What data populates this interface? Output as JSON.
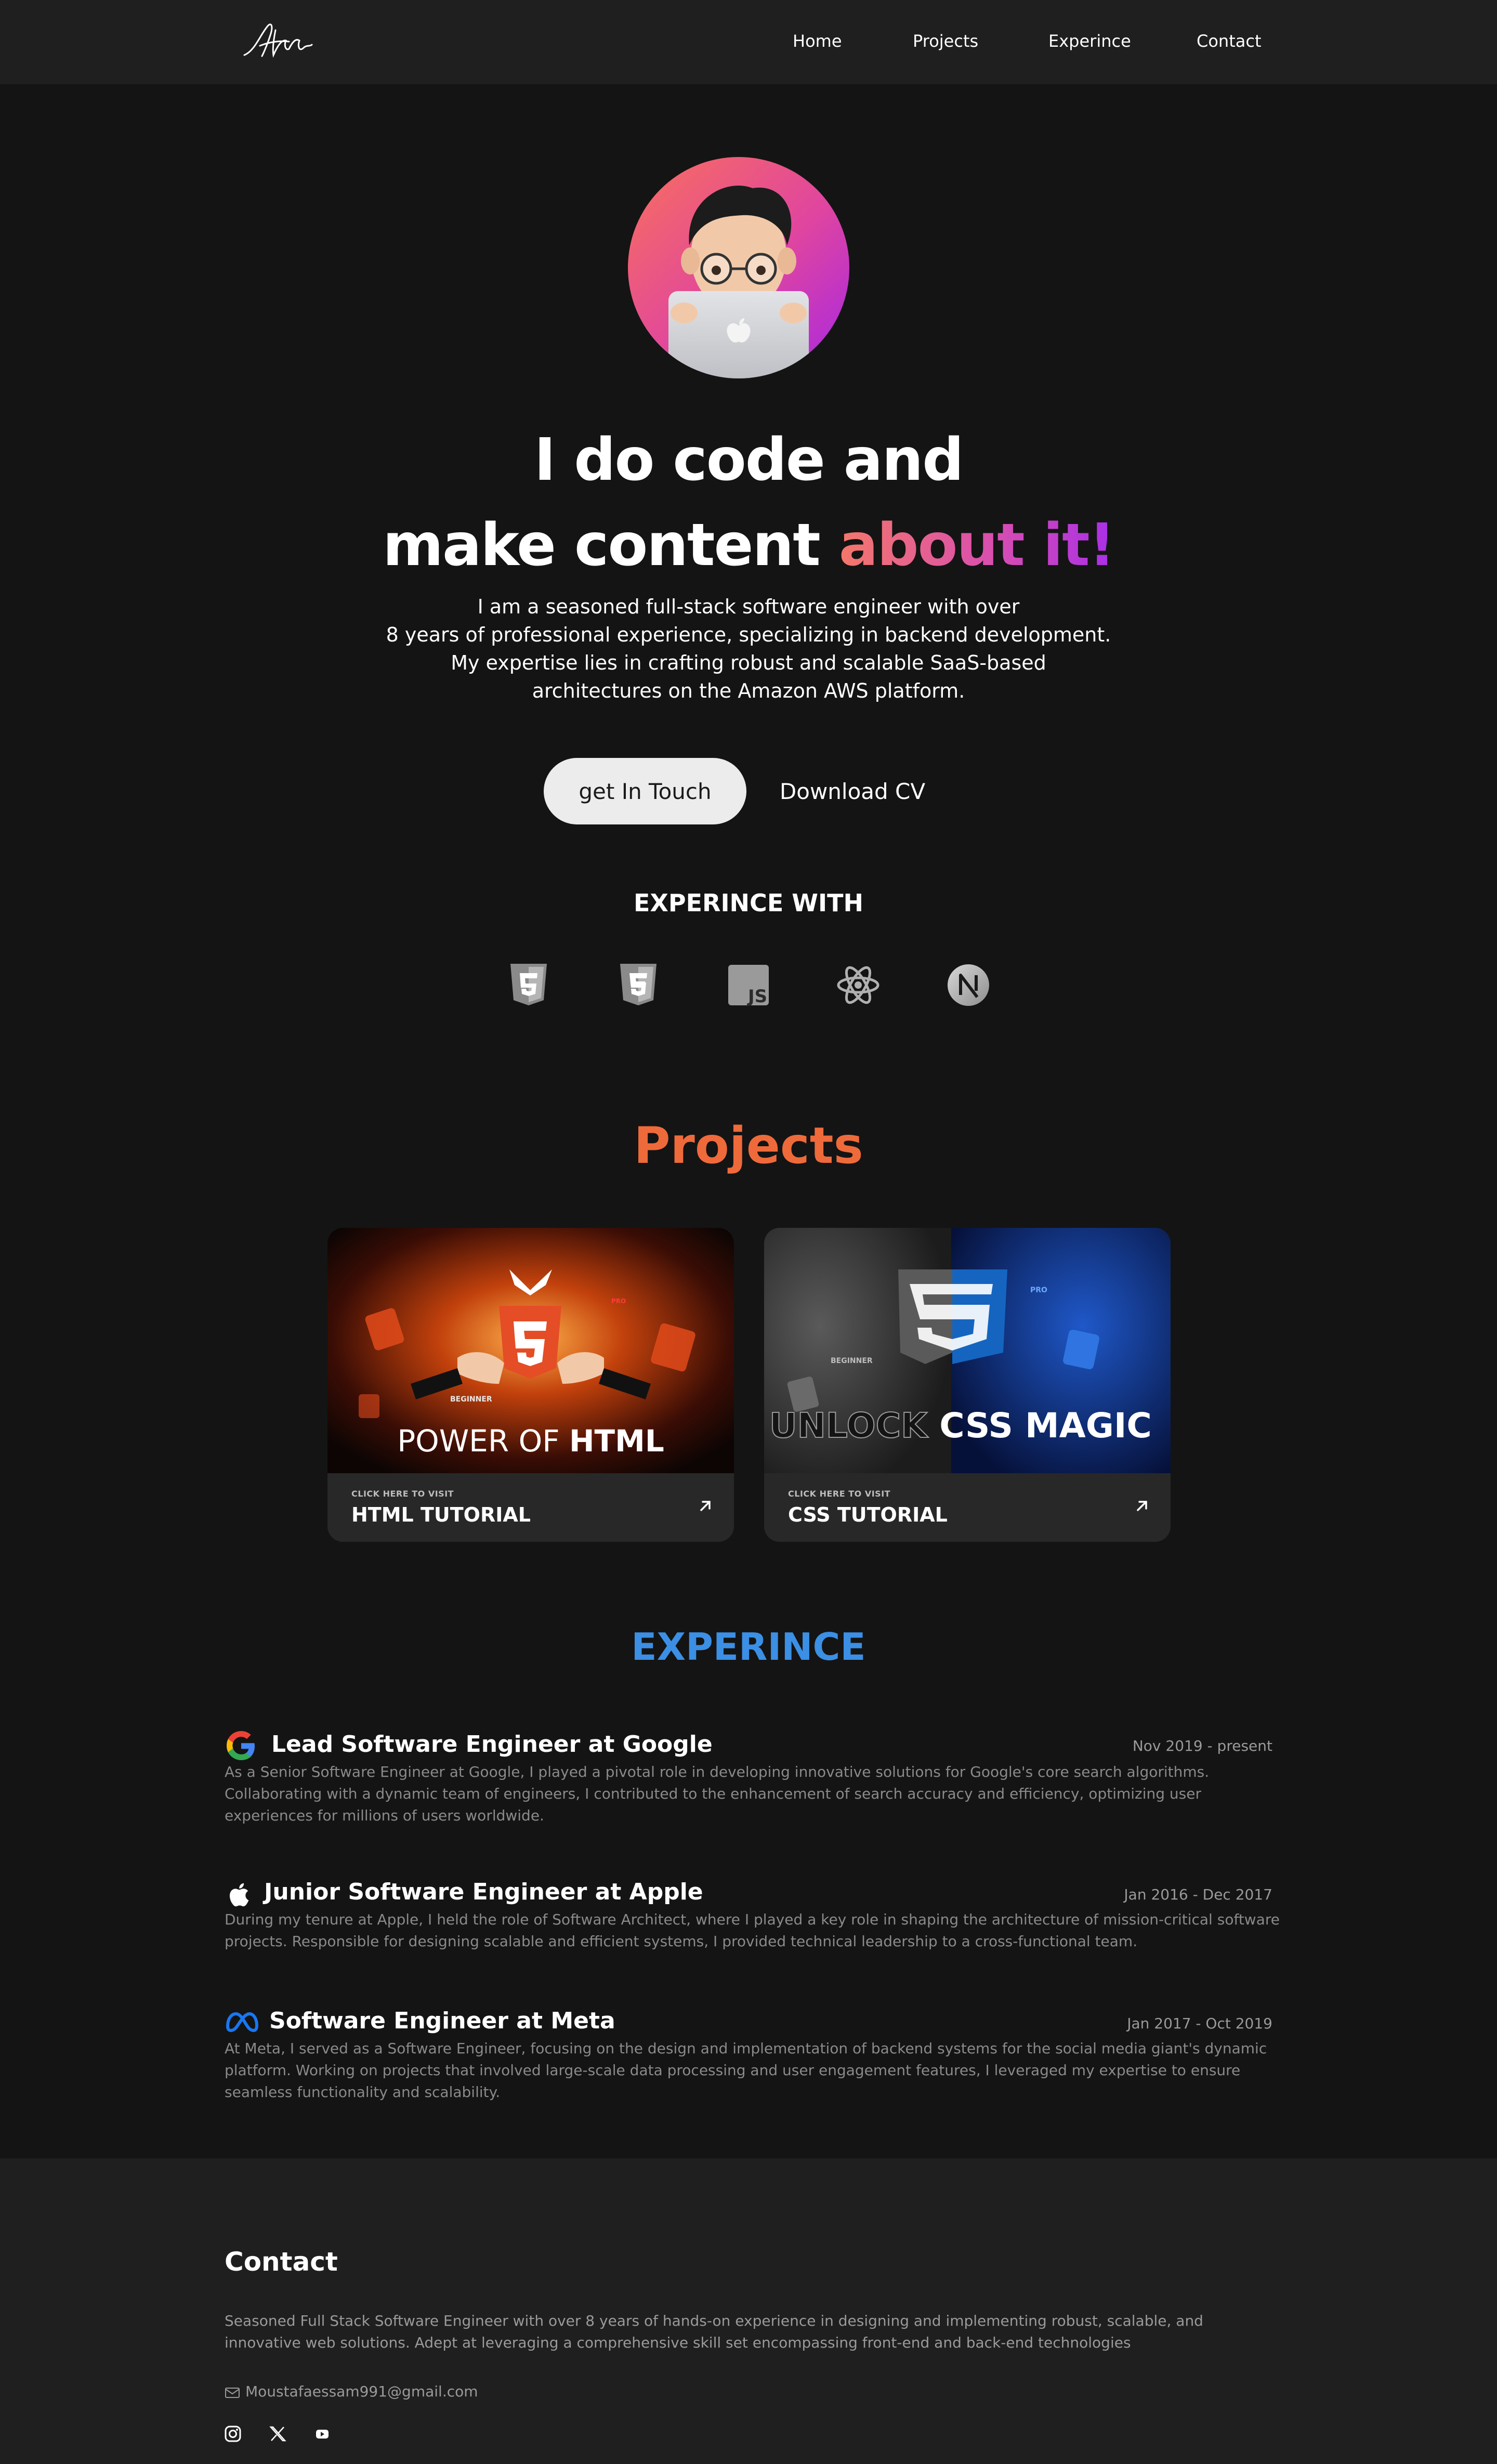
{
  "nav": {
    "logo_alt": "signature-logo",
    "links": [
      "Home",
      "Projects",
      "Experince",
      "Contact"
    ]
  },
  "hero": {
    "title_line1": "I do code and",
    "title_line2_plain": "make content ",
    "title_line2_accent": "about it!",
    "description": [
      "I am a seasoned full-stack software engineer with over",
      "8 years of professional experience, specializing in backend development.",
      "My expertise lies in crafting robust and scalable SaaS-based",
      "architectures on the Amazon AWS platform."
    ],
    "cta_primary": "get In Touch",
    "cta_secondary": "Download CV",
    "accent_gradient": [
      "#f4776b",
      "#d94fae",
      "#a92fe8"
    ]
  },
  "experience_with": {
    "title": "EXPERINCE WITH",
    "icons": [
      "html5-icon",
      "css3-icon",
      "javascript-icon",
      "react-icon",
      "nextjs-icon"
    ]
  },
  "projects": {
    "title": "Projects",
    "title_color": "#ef6a3a",
    "cards": [
      {
        "image_label_beginner": "BEGINNER",
        "image_label_pro": "PRO",
        "image_title_plain": "POWER OF ",
        "image_title_bold": "HTML",
        "small": "CLICK HERE TO VISIT",
        "big": "HTML TUTORIAL"
      },
      {
        "image_label_beginner": "BEGINNER",
        "image_label_pro": "PRO",
        "image_title_plain": "UNLOCK ",
        "image_title_bold": "CSS MAGIC",
        "small": "CLICK HERE TO VISIT",
        "big": "CSS TUTORIAL"
      }
    ]
  },
  "experience": {
    "title": "EXPERINCE",
    "title_color": "#3b8fe4",
    "items": [
      {
        "logo": "google-icon",
        "role": "Lead Software Engineer at Google",
        "date": "Nov 2019 - present",
        "description": [
          "As a Senior Software Engineer at Google, I played a pivotal role in developing innovative solutions for Google's core search algorithms.",
          "Collaborating with a dynamic team of engineers, I contributed to the enhancement of search accuracy and efficiency, optimizing user",
          "experiences for millions of users worldwide."
        ]
      },
      {
        "logo": "apple-icon",
        "role": "Junior Software Engineer at Apple",
        "date": "Jan 2016 - Dec 2017",
        "description": [
          "During my tenure at Apple, I held the role of Software Architect, where I played a key role in shaping the architecture of mission-critical software",
          "projects. Responsible for designing scalable and efficient systems, I provided technical leadership to a cross-functional team."
        ]
      },
      {
        "logo": "meta-icon",
        "role": "Software Engineer at Meta",
        "date": "Jan 2017 - Oct 2019",
        "description": [
          "At Meta, I served as a Software Engineer, focusing on the design and implementation of backend systems for the social media giant's dynamic",
          "platform. Working on projects that involved large-scale data processing and user engagement features, I leveraged my expertise to ensure",
          "seamless functionality and scalability."
        ]
      }
    ]
  },
  "contact": {
    "title": "Contact",
    "description": [
      "Seasoned Full Stack Software Engineer with over 8 years of hands-on experience in designing and implementing robust, scalable, and",
      "innovative web solutions. Adept at leveraging a comprehensive skill set encompassing front-end and back-end technologies"
    ],
    "email": "Moustafaessam991@gmail.com",
    "socials": [
      "instagram-icon",
      "x-twitter-icon",
      "youtube-icon"
    ]
  }
}
